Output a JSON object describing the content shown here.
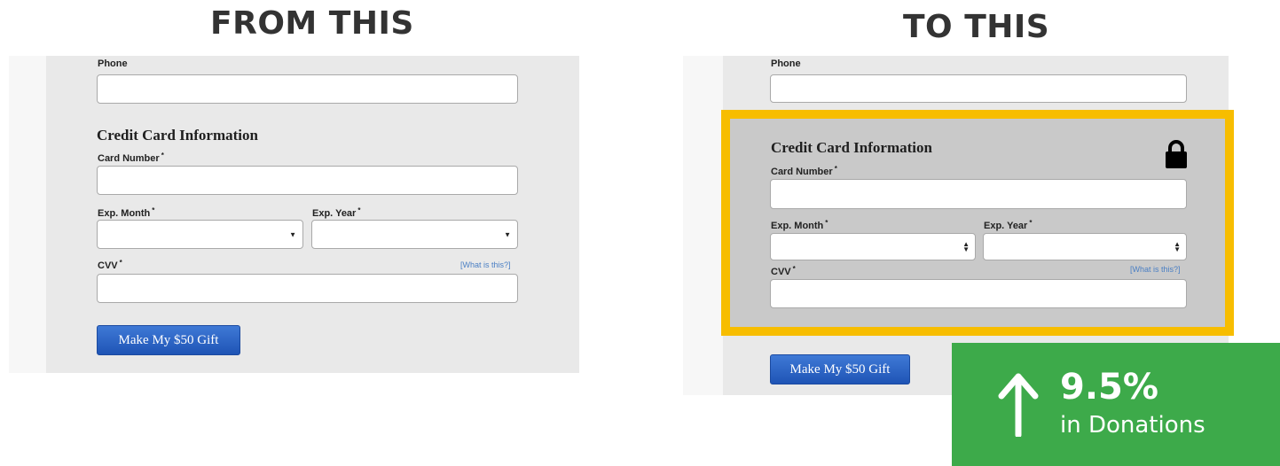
{
  "headings": {
    "before": "FROM THIS",
    "after": "TO THIS"
  },
  "before_form": {
    "phone_label": "Phone",
    "section_title": "Credit Card Information",
    "card_number_label": "Card Number",
    "exp_month_label": "Exp. Month",
    "exp_year_label": "Exp. Year",
    "cvv_label": "CVV",
    "required_marker": "*",
    "help_link": "[What is this?]",
    "submit_label": "Make My $50 Gift"
  },
  "after_form": {
    "phone_label": "Phone",
    "section_title": "Credit Card Information",
    "card_number_label": "Card Number",
    "exp_month_label": "Exp. Month",
    "exp_year_label": "Exp. Year",
    "cvv_label": "CVV",
    "required_marker": "*",
    "help_link": "[What is this?]",
    "submit_label": "Make My $50 Gift",
    "lock_icon": "lock-icon"
  },
  "result_badge": {
    "icon": "arrow-up-icon",
    "value": "9.5%",
    "caption": "in Donations"
  },
  "colors": {
    "highlight_border": "#f7bd00",
    "badge_background": "#3daa4a",
    "button_blue": "#2a62c6",
    "help_link": "#4a7fc4"
  }
}
